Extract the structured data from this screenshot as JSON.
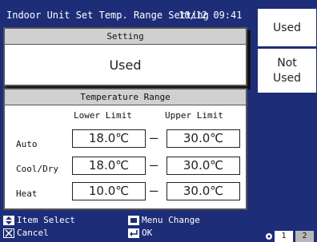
{
  "header": {
    "title": "Indoor Unit Set Temp. Range Setting",
    "datetime": "10/12 09:41"
  },
  "side_buttons": {
    "used": "Used",
    "not_used_line1": "Not",
    "not_used_line2": "Used"
  },
  "setting": {
    "header": "Setting",
    "value": "Used"
  },
  "temperature_range": {
    "header": "Temperature Range",
    "lower_limit_label": "Lower Limit",
    "upper_limit_label": "Upper Limit",
    "rows": [
      {
        "mode": "Auto",
        "lower": "18.0℃",
        "upper": "30.0℃"
      },
      {
        "mode": "Cool/Dry",
        "lower": "18.0℃",
        "upper": "30.0℃"
      },
      {
        "mode": "Heat",
        "lower": "10.0℃",
        "upper": "30.0℃"
      }
    ],
    "dash": "–"
  },
  "footer": {
    "item_select": "Item Select",
    "cancel": "Cancel",
    "menu_change": "Menu Change",
    "ok": "OK"
  },
  "pagination": {
    "pages": [
      "1",
      "2"
    ],
    "current": "1"
  },
  "colors": {
    "background": "#1d2d78",
    "panel_header": "#d0d0d0",
    "panel": "#ffffff"
  }
}
